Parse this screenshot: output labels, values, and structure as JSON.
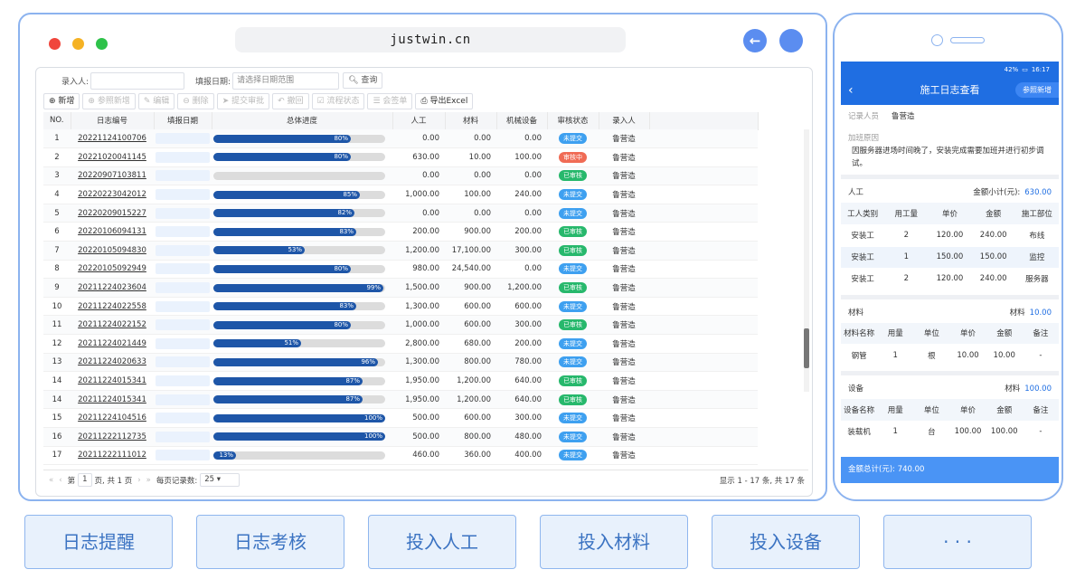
{
  "browser": {
    "url": "justwin.cn",
    "nav_back": "←"
  },
  "filter": {
    "recorder_label": "录入人:",
    "date_label": "填报日期:",
    "date_placeholder": "请选择日期范围",
    "query": "查询"
  },
  "toolbar": [
    "新增",
    "参照新增",
    "编辑",
    "删除",
    "提交审批",
    "撤回",
    "流程状态",
    "会签单",
    "导出Excel"
  ],
  "columns": [
    "NO.",
    "日志编号",
    "填报日期",
    "总体进度",
    "人工",
    "材料",
    "机械设备",
    "审核状态",
    "录入人"
  ],
  "rows": [
    {
      "no": "1",
      "code": "20221124100706",
      "progress": 80,
      "labor": "0.00",
      "material": "0.00",
      "equip": "0.00",
      "status": "未提交",
      "user": "鲁营造"
    },
    {
      "no": "2",
      "code": "20221020041145",
      "progress": 80,
      "labor": "630.00",
      "material": "10.00",
      "equip": "100.00",
      "status": "审核中",
      "user": "鲁营造"
    },
    {
      "no": "3",
      "code": "20220907103811",
      "progress": 0,
      "labor": "0.00",
      "material": "0.00",
      "equip": "0.00",
      "status": "已审核",
      "user": "鲁营造"
    },
    {
      "no": "4",
      "code": "20220223042012",
      "progress": 85,
      "labor": "1,000.00",
      "material": "100.00",
      "equip": "240.00",
      "status": "未提交",
      "user": "鲁营造"
    },
    {
      "no": "5",
      "code": "20220209015227",
      "progress": 82,
      "labor": "0.00",
      "material": "0.00",
      "equip": "0.00",
      "status": "未提交",
      "user": "鲁营造"
    },
    {
      "no": "6",
      "code": "20220106094131",
      "progress": 83,
      "labor": "200.00",
      "material": "900.00",
      "equip": "200.00",
      "status": "已审核",
      "user": "鲁营造"
    },
    {
      "no": "7",
      "code": "20220105094830",
      "progress": 53,
      "labor": "1,200.00",
      "material": "17,100.00",
      "equip": "300.00",
      "status": "已审核",
      "user": "鲁营造"
    },
    {
      "no": "8",
      "code": "20220105092949",
      "progress": 80,
      "labor": "980.00",
      "material": "24,540.00",
      "equip": "0.00",
      "status": "未提交",
      "user": "鲁营造"
    },
    {
      "no": "9",
      "code": "20211224023604",
      "progress": 99,
      "labor": "1,500.00",
      "material": "900.00",
      "equip": "1,200.00",
      "status": "已审核",
      "user": "鲁营造"
    },
    {
      "no": "10",
      "code": "20211224022558",
      "progress": 83,
      "labor": "1,300.00",
      "material": "600.00",
      "equip": "600.00",
      "status": "未提交",
      "user": "鲁营造"
    },
    {
      "no": "11",
      "code": "20211224022152",
      "progress": 80,
      "labor": "1,000.00",
      "material": "600.00",
      "equip": "300.00",
      "status": "已审核",
      "user": "鲁营造"
    },
    {
      "no": "12",
      "code": "20211224021449",
      "progress": 51,
      "labor": "2,800.00",
      "material": "680.00",
      "equip": "200.00",
      "status": "未提交",
      "user": "鲁营造"
    },
    {
      "no": "13",
      "code": "20211224020633",
      "progress": 96,
      "labor": "1,300.00",
      "material": "800.00",
      "equip": "780.00",
      "status": "未提交",
      "user": "鲁营造"
    },
    {
      "no": "14",
      "code": "20211224015341",
      "progress": 87,
      "labor": "1,950.00",
      "material": "1,200.00",
      "equip": "640.00",
      "status": "已审核",
      "user": "鲁营造"
    },
    {
      "no": "14",
      "code": "20211224015341",
      "progress": 87,
      "labor": "1,950.00",
      "material": "1,200.00",
      "equip": "640.00",
      "status": "已审核",
      "user": "鲁营造"
    },
    {
      "no": "15",
      "code": "20211224104516",
      "progress": 100,
      "labor": "500.00",
      "material": "600.00",
      "equip": "300.00",
      "status": "未提交",
      "user": "鲁营造"
    },
    {
      "no": "16",
      "code": "20211222112735",
      "progress": 100,
      "labor": "500.00",
      "material": "800.00",
      "equip": "480.00",
      "status": "未提交",
      "user": "鲁营造"
    },
    {
      "no": "17",
      "code": "20211222111012",
      "progress": 13,
      "labor": "460.00",
      "material": "360.00",
      "equip": "400.00",
      "status": "未提交",
      "user": "鲁营造"
    }
  ],
  "status_colors": {
    "未提交": "#3ea0f0",
    "审核中": "#f06b55",
    "已审核": "#27b86c"
  },
  "pager": {
    "first": "«",
    "prev": "‹",
    "page_label": "第",
    "page": "1",
    "page_suffix": "页, 共 1 页",
    "next": "›",
    "last": "»",
    "size_label": "每页记录数:",
    "size": "25",
    "summary": "显示 1 - 17 条, 共 17 条"
  },
  "phone": {
    "status": "16:17",
    "status_left": "42%",
    "title": "施工日志查看",
    "back": "‹",
    "recorder_label": "记录人员",
    "recorder": "鲁营造",
    "tag": "参照新增",
    "reason_label": "加班原因",
    "reason": "因服务器进场时间晚了，安装完成需要加班并进行初步调试。",
    "labor": {
      "title": "人工",
      "sub_label": "金额小计(元):",
      "sub": "630.00",
      "headers": [
        "工人类别",
        "用工量",
        "单价",
        "金额",
        "施工部位"
      ],
      "rows": [
        [
          "安装工",
          "2",
          "120.00",
          "240.00",
          "布线"
        ],
        [
          "安装工",
          "1",
          "150.00",
          "150.00",
          "监控"
        ],
        [
          "安装工",
          "2",
          "120.00",
          "240.00",
          "服务器"
        ]
      ]
    },
    "material": {
      "title": "材料",
      "sub_label": "材料",
      "sub": "10.00",
      "headers": [
        "材料名称",
        "用量",
        "单位",
        "单价",
        "金额",
        "备注"
      ],
      "rows": [
        [
          "钢管",
          "1",
          "根",
          "10.00",
          "10.00",
          "-"
        ]
      ]
    },
    "equip": {
      "title": "设备",
      "sub_label": "材料",
      "sub": "100.00",
      "headers": [
        "设备名称",
        "用量",
        "单位",
        "单价",
        "金额",
        "备注"
      ],
      "rows": [
        [
          "装载机",
          "1",
          "台",
          "100.00",
          "100.00",
          "-"
        ]
      ]
    },
    "total": "金额总计(元):  740.00"
  },
  "tiles": [
    "日志提醒",
    "日志考核",
    "投入人工",
    "投入材料",
    "投入设备",
    "· · ·"
  ]
}
